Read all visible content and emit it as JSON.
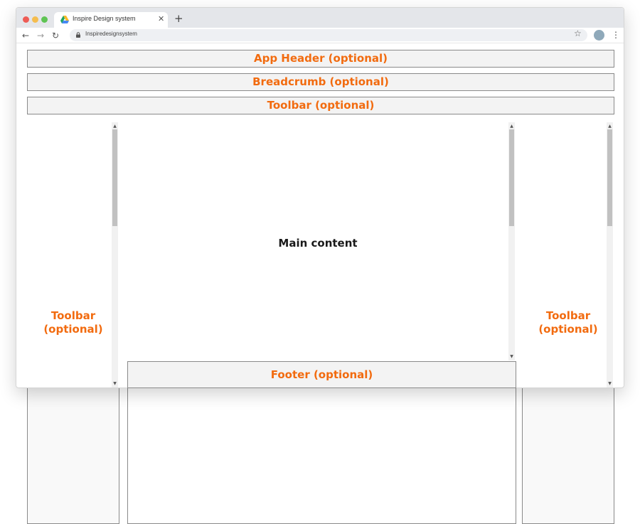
{
  "browser": {
    "tab_title": "Inspire Design system",
    "tab_close": "✕",
    "new_tab": "+",
    "url": "Inspiredesignsystem",
    "back": "←",
    "forward": "→",
    "reload": "↻",
    "star": "☆",
    "menu": "⋮"
  },
  "layout": {
    "app_header": "App Header (optional)",
    "breadcrumb": "Breadcrumb (optional)",
    "toolbar_top": "Toolbar (optional)",
    "left_toolbar": "Toolbar\n(optional)",
    "right_toolbar": "Toolbar\n(optional)",
    "main_content": "Main content",
    "footer": "Footer (optional)"
  },
  "colors": {
    "label_accent": "#f26b0f",
    "region_border": "#8a8a8a",
    "region_fill": "#f3f3f3"
  },
  "icons": {
    "favicon": "google-drive-icon",
    "lock": "lock-icon",
    "avatar": "profile-avatar"
  }
}
